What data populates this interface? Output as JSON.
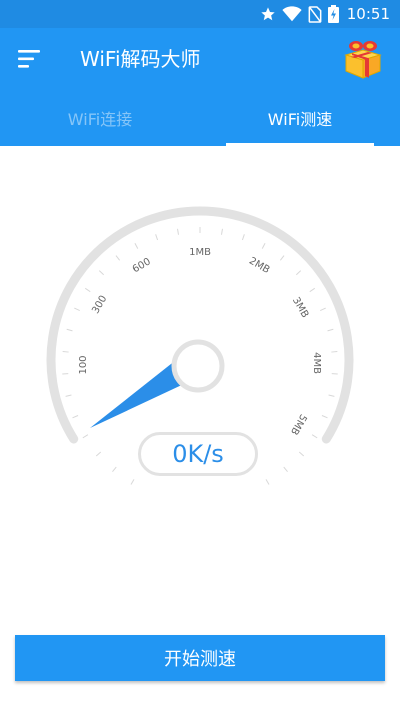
{
  "status_bar": {
    "time": "10:51",
    "icons": [
      "star-icon",
      "wifi-icon",
      "no-sim-icon",
      "battery-charging-icon"
    ]
  },
  "app_bar": {
    "title": "WiFi解码大师",
    "menu_icon": "hamburger-menu-icon",
    "gift_icon": "gift-box-icon"
  },
  "tabs": [
    {
      "label": "WiFi连接",
      "active": false
    },
    {
      "label": "WiFi测速",
      "active": true
    }
  ],
  "gauge": {
    "tick_labels": [
      "100",
      "300",
      "600",
      "1MB",
      "2MB",
      "3MB",
      "4MB",
      "5MB"
    ],
    "current_speed": "0K/s"
  },
  "actions": {
    "start_label": "开始测速"
  },
  "colors": {
    "primary": "#2196f3",
    "status_bar": "#1f8be3",
    "needle": "#2b8ee8",
    "gauge_track": "#e2e2e2"
  }
}
